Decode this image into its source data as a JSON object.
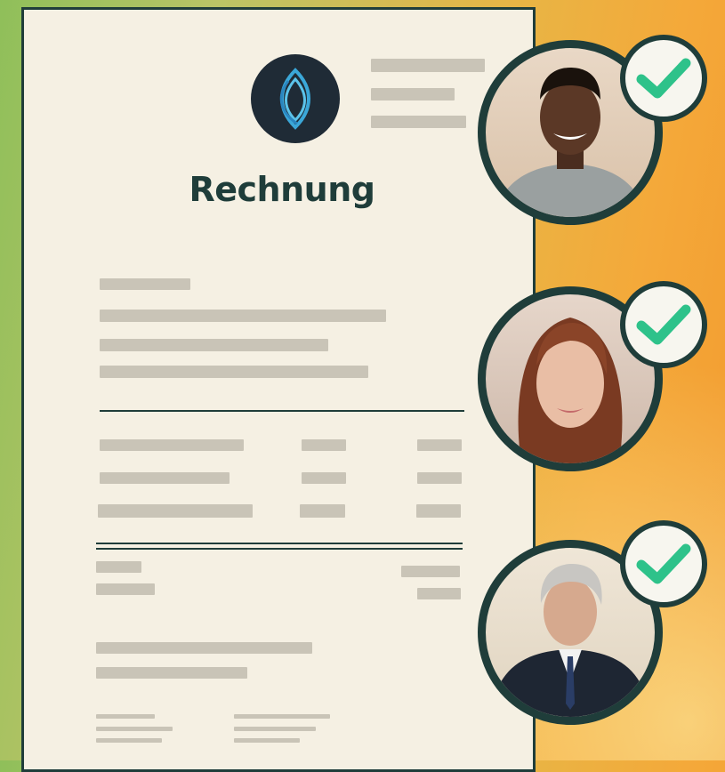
{
  "document": {
    "title": "Rechnung"
  },
  "colors": {
    "accent_dark": "#1f3d3a",
    "check_green": "#2ec28a",
    "paper": "#f5f0e3"
  },
  "approvers": [
    {
      "name": "approver-1",
      "status": "approved",
      "icon": "check-icon"
    },
    {
      "name": "approver-2",
      "status": "approved",
      "icon": "check-icon"
    },
    {
      "name": "approver-3",
      "status": "approved",
      "icon": "check-icon"
    }
  ]
}
